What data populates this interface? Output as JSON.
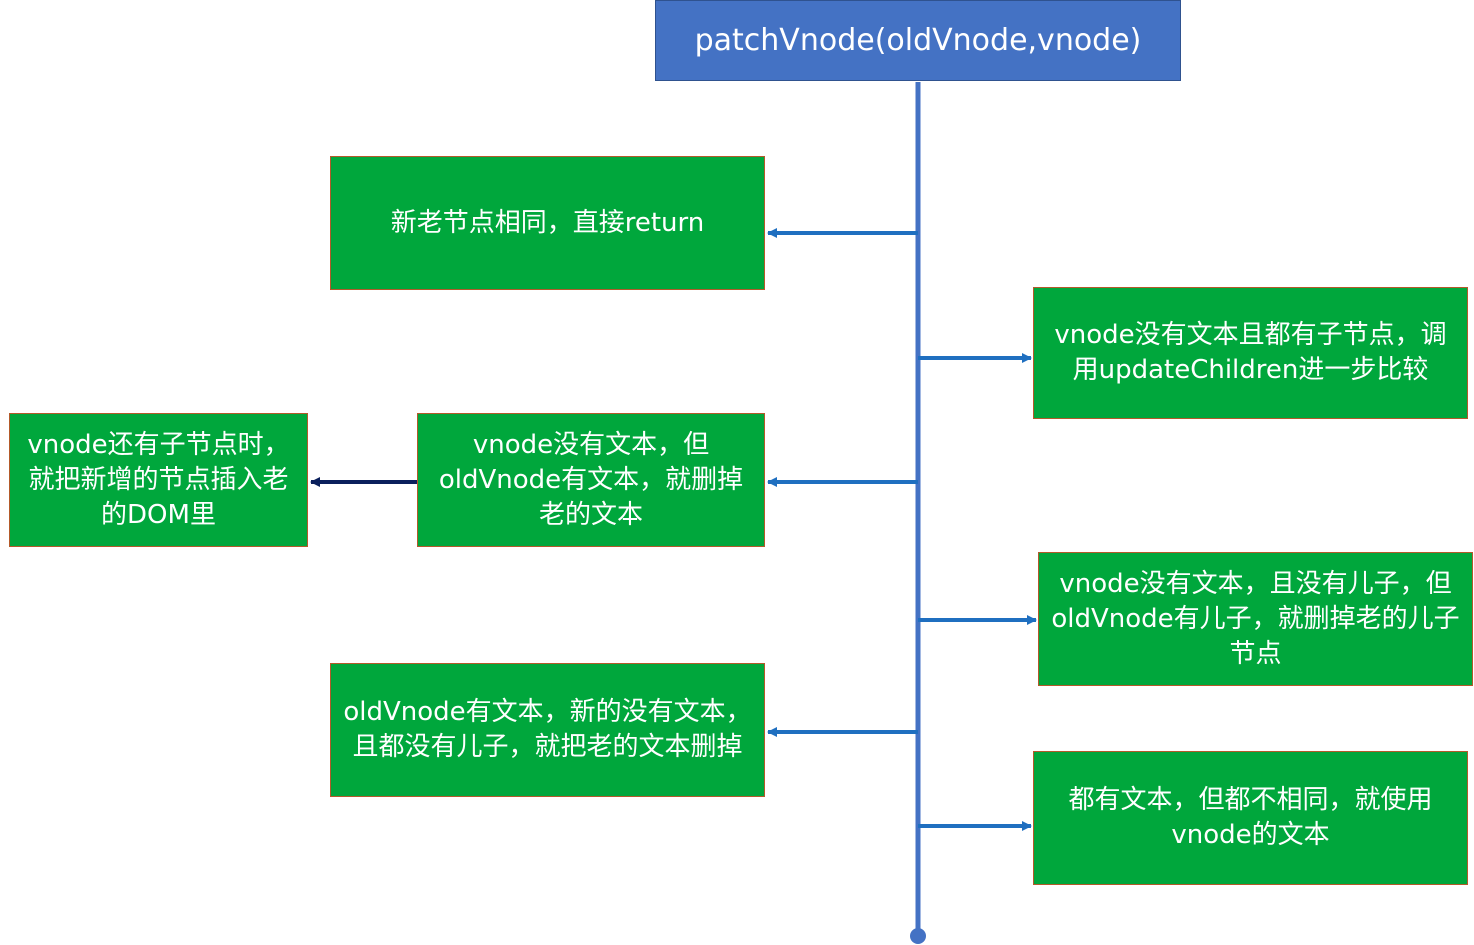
{
  "title": "patchVnode(oldVnode,vnode)",
  "colors": {
    "title_fill": "#4472c4",
    "node_fill": "#00a73c",
    "node_border": "#b35a2a",
    "connector": "#1f6fc0",
    "spine": "#4472c4",
    "secondary_arrow": "#0a1f5c"
  },
  "nodes": [
    {
      "id": "same",
      "text": "新老节点相同，直接return"
    },
    {
      "id": "update_children",
      "text": "vnode没有文本且都有子节点，调用updateChildren进一步比较"
    },
    {
      "id": "delete_old_text",
      "text": "vnode没有文本，但oldVnode有文本，就删掉老的文本"
    },
    {
      "id": "insert_children",
      "text": "vnode还有子节点时，就把新增的节点插入老的DOM里"
    },
    {
      "id": "remove_children",
      "text": "vnode没有文本，且没有儿子，但oldVnode有儿子，就删掉老的儿子节点"
    },
    {
      "id": "delete_text",
      "text": "oldVnode有文本，新的没有文本，且都没有儿子，就把老的文本删掉"
    },
    {
      "id": "use_vnode_text",
      "text": "都有文本，但都不相同，就使用vnode的文本"
    }
  ]
}
